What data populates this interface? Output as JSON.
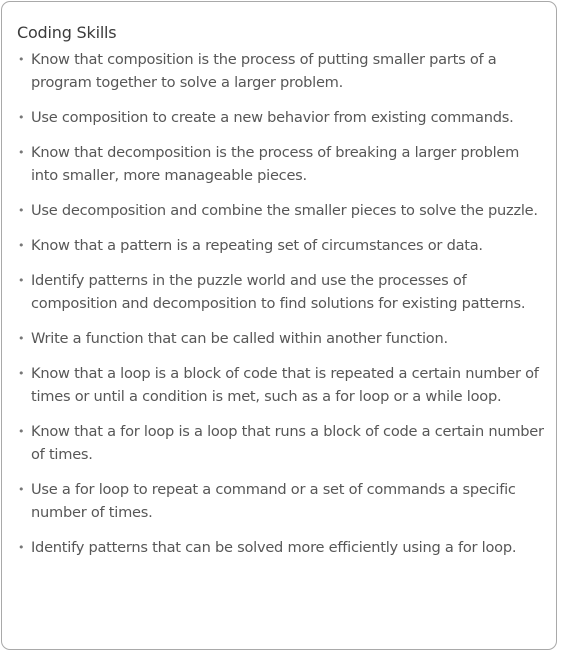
{
  "card": {
    "title": "Coding Skills",
    "bullet_glyph": "•",
    "items": [
      {
        "text": "Know that composition is the process of putting smaller parts of a program together to solve a larger problem."
      },
      {
        "text": "Use composition to create a new behavior from existing commands."
      },
      {
        "text": "Know that decomposition is the process of breaking a larger problem into smaller, more manageable pieces."
      },
      {
        "text": "Use decomposition and combine the smaller pieces to solve the puzzle."
      },
      {
        "text": "Know that a pattern is a repeating set of circumstances or data."
      },
      {
        "text": "Identify patterns in the puzzle world and use the processes of composition and decomposition to find solutions for existing patterns."
      },
      {
        "text": "Write a function that can be called within another function."
      },
      {
        "text": "Know that a loop is a block of code that is repeated a certain number of times or until a condition is met, such as a for loop or a while loop."
      },
      {
        "text": "Know that a for loop is a loop that runs a block of code a certain number of times."
      },
      {
        "text": "Use a for loop to repeat a command or a set of commands a specific number of times."
      },
      {
        "text": "Identify patterns that can be solved more efficiently using a for loop."
      }
    ]
  },
  "colors": {
    "border": "#a9a9a9",
    "title": "#3c3c3c",
    "text": "#575757",
    "background": "#ffffff"
  }
}
